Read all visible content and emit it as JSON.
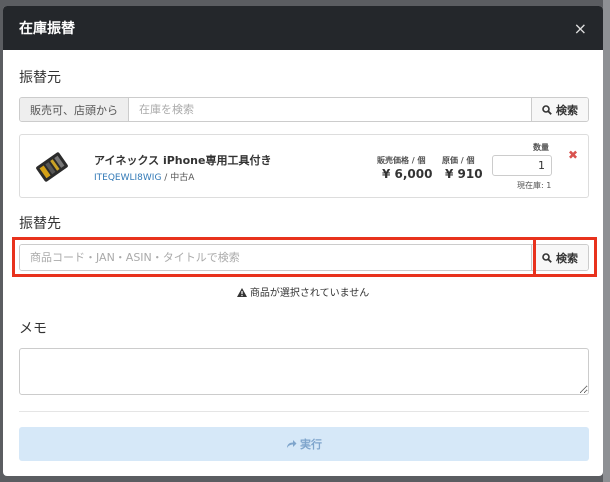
{
  "modal": {
    "title": "在庫振替",
    "close": "×"
  },
  "source": {
    "label": "振替元",
    "filter_addon": "販売可、店頭から",
    "search_placeholder": "在庫を検索",
    "search_button": "検索"
  },
  "item": {
    "name": "アイネックス iPhone専用工具付き",
    "sku": "ITEQEWLI8WIG",
    "condition": "中古A",
    "sale_price_label": "販売価格 / 個",
    "sale_price": "¥ 6,000",
    "cost_label": "原価 / 個",
    "cost": "¥ 910",
    "qty_label": "数量",
    "qty": "1",
    "stock_text": "現在庫: 1",
    "remove": "✖"
  },
  "destination": {
    "label": "振替先",
    "search_placeholder": "商品コード・JAN・ASIN・タイトルで検索",
    "search_button": "検索",
    "warning": "商品が選択されていません"
  },
  "memo": {
    "label": "メモ",
    "value": ""
  },
  "execute": {
    "label": "実行"
  },
  "colors": {
    "header_bg": "#24272b",
    "highlight": "#e8321d",
    "link": "#337ab7",
    "remove": "#d9534f",
    "exec_bg": "#d6e8f8"
  },
  "icons": {
    "search": "search-icon",
    "warning": "warning-icon",
    "share": "share-icon",
    "remove": "close-icon"
  }
}
